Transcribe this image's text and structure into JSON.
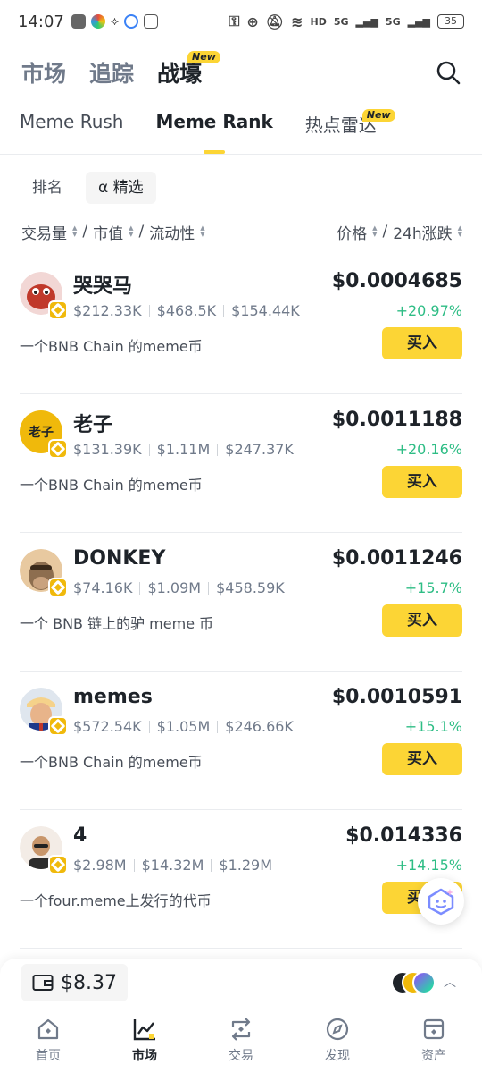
{
  "status_bar": {
    "time": "14:07",
    "network1": "HD",
    "network2": "5G",
    "network3": "5G",
    "battery": "35"
  },
  "top_tabs": [
    {
      "label": "市场",
      "active": false
    },
    {
      "label": "追踪",
      "active": false
    },
    {
      "label": "战壕",
      "active": true,
      "badge": "New"
    }
  ],
  "sub_tabs": [
    {
      "label": "Meme Rush",
      "active": false
    },
    {
      "label": "Meme Rank",
      "active": true
    },
    {
      "label": "热点雷达",
      "active": false,
      "badge": "New"
    }
  ],
  "chips": [
    {
      "label": "排名",
      "active": false
    },
    {
      "label": "α 精选",
      "active": true
    }
  ],
  "sort_header": {
    "volume": "交易量",
    "market_cap": "市值",
    "liquidity": "流动性",
    "price": "价格",
    "change": "24h涨跌"
  },
  "tokens": [
    {
      "name": "哭哭马",
      "volume": "$212.33K",
      "market_cap": "$468.5K",
      "liquidity": "$154.44K",
      "desc": "一个BNB Chain 的meme币",
      "price": "$0.0004685",
      "change": "+20.97%",
      "buy": "买入",
      "avatar_color": "#c0392b"
    },
    {
      "name": "老子",
      "volume": "$131.39K",
      "market_cap": "$1.11M",
      "liquidity": "$247.37K",
      "desc": "一个BNB Chain 的meme币",
      "price": "$0.0011188",
      "change": "+20.16%",
      "buy": "买入",
      "avatar_color": "#f0b90b",
      "avatar_text": "老子"
    },
    {
      "name": "DONKEY",
      "volume": "$74.16K",
      "market_cap": "$1.09M",
      "liquidity": "$458.59K",
      "desc": "一个 BNB 链上的驴 meme 币",
      "price": "$0.0011246",
      "change": "+15.7%",
      "buy": "买入",
      "avatar_color": "#a07850"
    },
    {
      "name": "memes",
      "volume": "$572.54K",
      "market_cap": "$1.05M",
      "liquidity": "$246.66K",
      "desc": "一个BNB Chain 的meme币",
      "price": "$0.0010591",
      "change": "+15.1%",
      "buy": "买入",
      "avatar_color": "#d4a373"
    },
    {
      "name": "4",
      "volume": "$2.98M",
      "market_cap": "$14.32M",
      "liquidity": "$1.29M",
      "desc": "一个four.meme上发行的代币",
      "price": "$0.014336",
      "change": "+14.15%",
      "buy": "买入",
      "avatar_color": "#8d6e63"
    }
  ],
  "wallet": {
    "balance": "$8.37"
  },
  "bottom_nav": [
    {
      "label": "首页",
      "active": false
    },
    {
      "label": "市场",
      "active": true
    },
    {
      "label": "交易",
      "active": false
    },
    {
      "label": "发现",
      "active": false
    },
    {
      "label": "资产",
      "active": false
    }
  ],
  "colors": {
    "accent": "#fcd535",
    "up": "#2ebd85",
    "text": "#1e2329",
    "muted": "#707a8a"
  }
}
